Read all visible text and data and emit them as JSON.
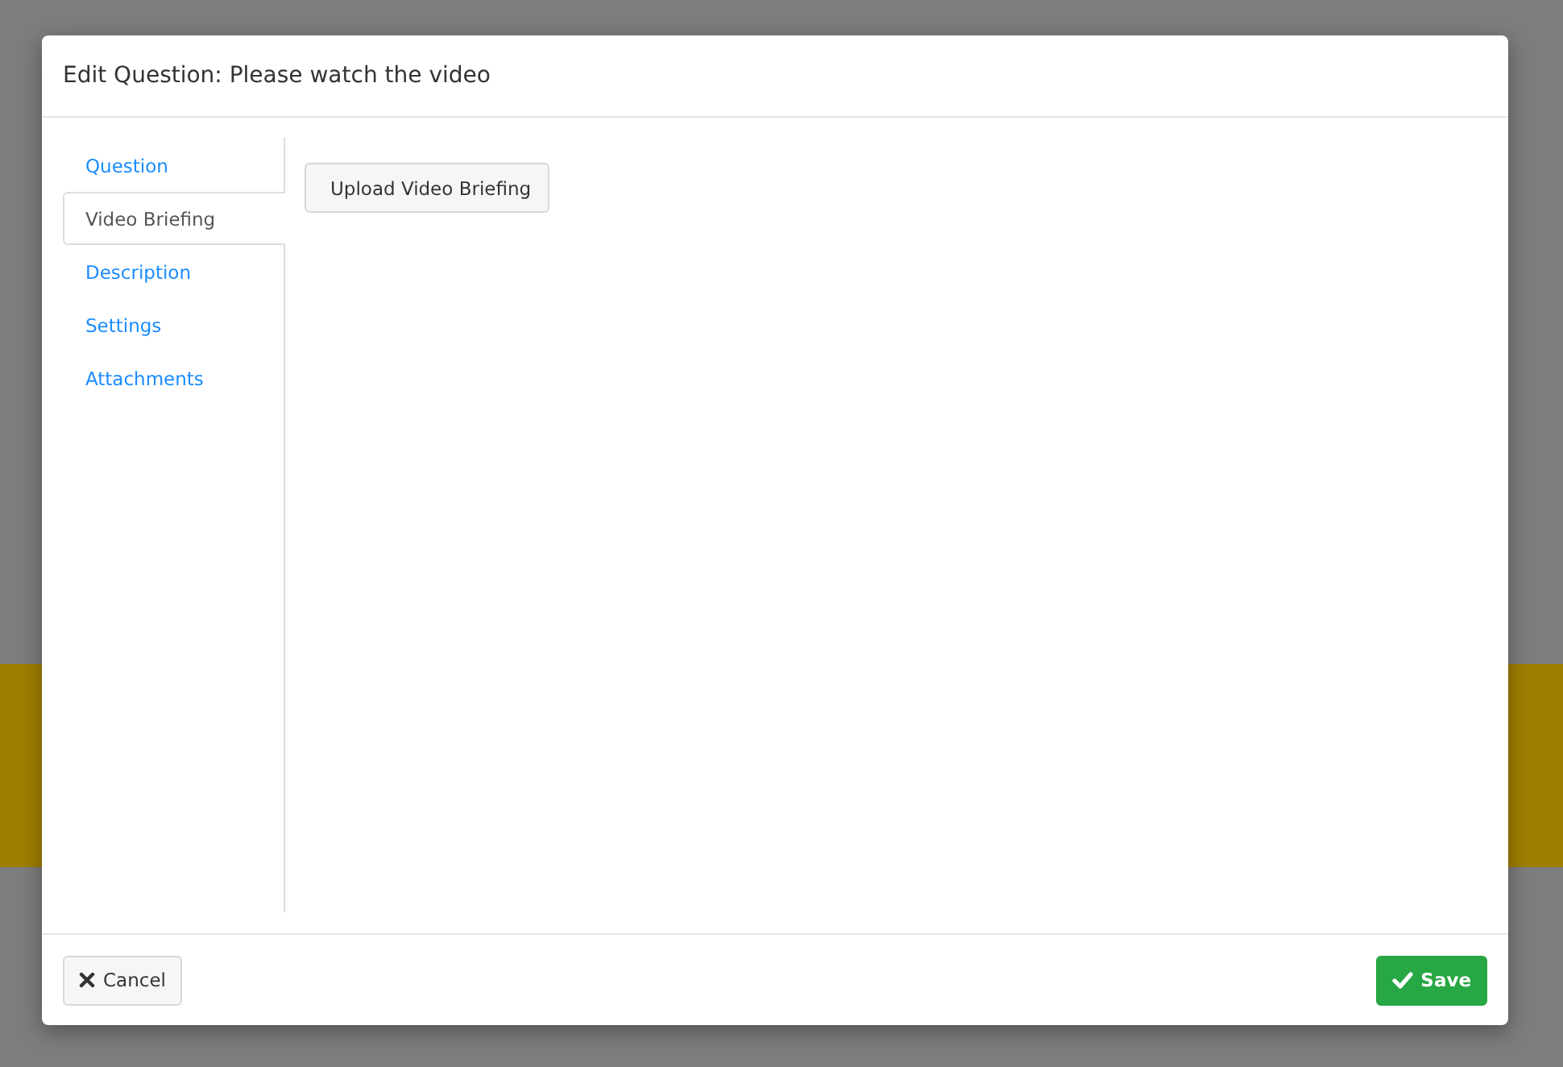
{
  "modal": {
    "title": "Edit Question: Please watch the video",
    "tabs": [
      {
        "label": "Question",
        "selected": false
      },
      {
        "label": "Video Briefing",
        "selected": true
      },
      {
        "label": "Description",
        "selected": false
      },
      {
        "label": "Settings",
        "selected": false
      },
      {
        "label": "Attachments",
        "selected": false
      }
    ],
    "upload_button": "Upload Video Briefing",
    "cancel_button": "Cancel",
    "save_button": "Save"
  }
}
